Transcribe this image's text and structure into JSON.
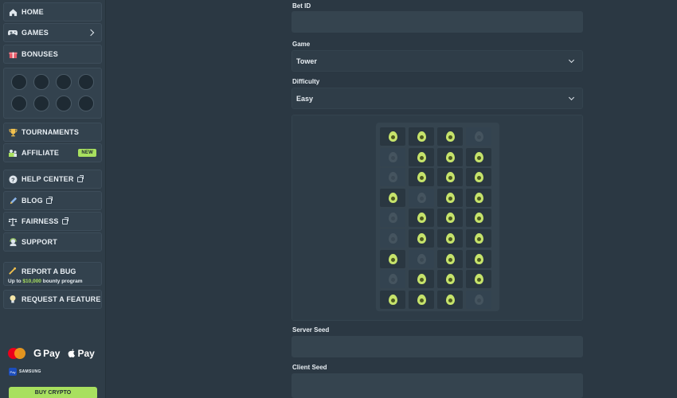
{
  "sidebar": {
    "home": "HOME",
    "games": "GAMES",
    "bonuses": "BONUSES",
    "tournaments": "TOURNAMENTS",
    "affiliate": "AFFILIATE",
    "affiliate_badge": "NEW",
    "help_center": "HELP CENTER",
    "blog": "BLOG",
    "fairness": "FAIRNESS",
    "support": "SUPPORT",
    "report_bug": "REPORT A BUG",
    "report_sub_prefix": "Up to ",
    "report_sub_amount": "$10,000",
    "report_sub_suffix": " bounty program",
    "request_feature": "REQUEST A FEATURE",
    "payments": {
      "gpay": "Pay",
      "apay": "Pay",
      "samsung_icon": "Pay",
      "samsung": "SAMSUNG"
    },
    "buy_crypto": "BUY CRYPTO"
  },
  "form": {
    "bet_id_label": "Bet ID",
    "game_label": "Game",
    "game_value": "Tower",
    "difficulty_label": "Difficulty",
    "difficulty_value": "Easy",
    "server_seed_label": "Server Seed",
    "client_seed_label": "Client Seed"
  },
  "tower": {
    "columns": 4,
    "rows": [
      [
        1,
        1,
        1,
        0
      ],
      [
        0,
        1,
        1,
        1
      ],
      [
        0,
        1,
        1,
        1
      ],
      [
        1,
        0,
        1,
        1
      ],
      [
        0,
        1,
        1,
        1
      ],
      [
        0,
        1,
        1,
        1
      ],
      [
        1,
        0,
        1,
        1
      ],
      [
        0,
        1,
        1,
        1
      ],
      [
        1,
        1,
        1,
        0
      ]
    ]
  },
  "colors": {
    "accent": "#a8e05f",
    "avocado": "#c6e36b"
  }
}
